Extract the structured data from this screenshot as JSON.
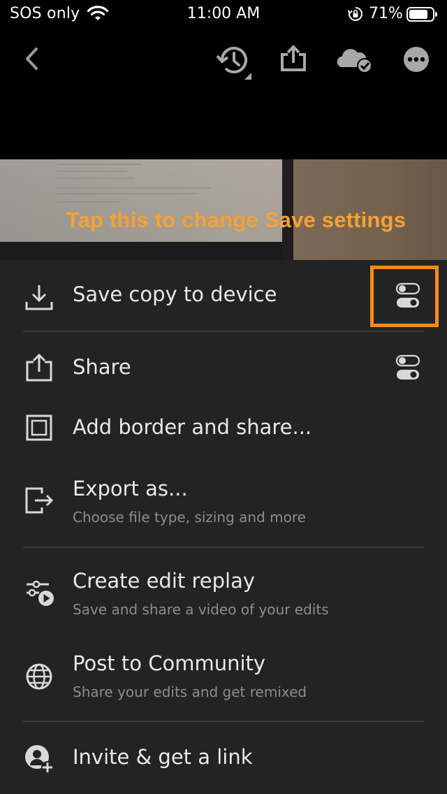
{
  "status_bar": {
    "carrier": "SOS only",
    "time": "11:00 AM",
    "battery_percent": "71%",
    "icons": [
      "wifi-icon",
      "orientation-lock-icon",
      "battery-icon"
    ]
  },
  "toolbar": {
    "icons": [
      "back-chevron-icon",
      "history-icon",
      "share-export-icon",
      "cloud-synced-icon",
      "more-icon"
    ]
  },
  "photo": {
    "caption": "Tap this to change Save settings"
  },
  "menu": {
    "items": [
      {
        "title": "Save copy to device",
        "subtitle": "",
        "icon": "download-icon",
        "has_settings": true
      },
      {
        "title": "Share",
        "subtitle": "",
        "icon": "share-icon",
        "has_settings": true
      },
      {
        "title": "Add border and share...",
        "subtitle": "",
        "icon": "border-icon",
        "has_settings": false
      },
      {
        "title": "Export as...",
        "subtitle": "Choose file type, sizing and more",
        "icon": "export-icon",
        "has_settings": false
      },
      {
        "title": "Create edit replay",
        "subtitle": "Save and share a video of your edits",
        "icon": "edit-replay-icon",
        "has_settings": false
      },
      {
        "title": "Post to Community",
        "subtitle": "Share your edits and get remixed",
        "icon": "globe-icon",
        "has_settings": false
      },
      {
        "title": "Invite & get a link",
        "subtitle": "",
        "icon": "invite-user-icon",
        "has_settings": false
      }
    ]
  },
  "colors": {
    "accent_orange": "#f58d14",
    "caption_orange": "#f7a134",
    "sheet_bg": "#232323"
  }
}
